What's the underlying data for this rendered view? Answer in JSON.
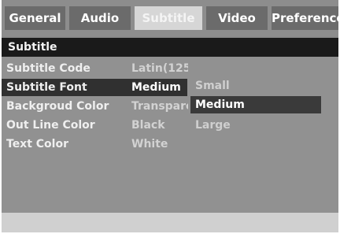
{
  "tabs": [
    "General",
    "Audio",
    "Subtitle",
    "Video",
    "Preference"
  ],
  "section_title": "Subtitle",
  "rows": [
    {
      "label": "Subtitle Code",
      "value": "Latin(125"
    },
    {
      "label": "Subtitle Font",
      "value": "Medium"
    },
    {
      "label": "Backgroud Color",
      "value": "Transpare"
    },
    {
      "label": "Out Line Color",
      "value": "Black"
    },
    {
      "label": "Text Color",
      "value": "White"
    }
  ],
  "font_options": [
    "Small",
    "Medium",
    "Large"
  ],
  "colors": {
    "background": "#8a8a8a",
    "active_tab": "#d6d6d6",
    "header_bar": "#1a1a1a",
    "selection": "#303030"
  }
}
